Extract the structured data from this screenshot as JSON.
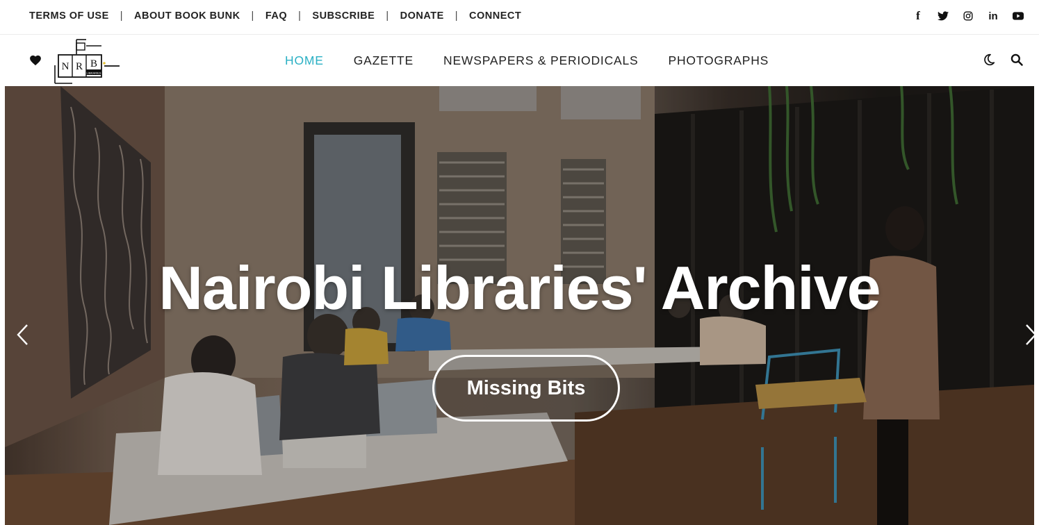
{
  "topbar": {
    "links": [
      "TERMS OF USE",
      "ABOUT BOOK BUNK",
      "FAQ",
      "SUBSCRIBE",
      "DONATE",
      "CONNECT"
    ],
    "separator": "|",
    "social": {
      "facebook": "f",
      "linkedin": "in"
    }
  },
  "logo": {
    "letters": [
      "N",
      "R",
      "B"
    ],
    "caption": "LIBRARIES"
  },
  "nav": {
    "items": [
      {
        "label": "HOME",
        "active": true
      },
      {
        "label": "GAZETTE",
        "active": false
      },
      {
        "label": "NEWSPAPERS & PERIODICALS",
        "active": false
      },
      {
        "label": "PHOTOGRAPHS",
        "active": false
      }
    ],
    "active_color": "#2ab0c4"
  },
  "hero": {
    "title": "Nairobi Libraries' Archive",
    "button_label": "Missing Bits"
  }
}
